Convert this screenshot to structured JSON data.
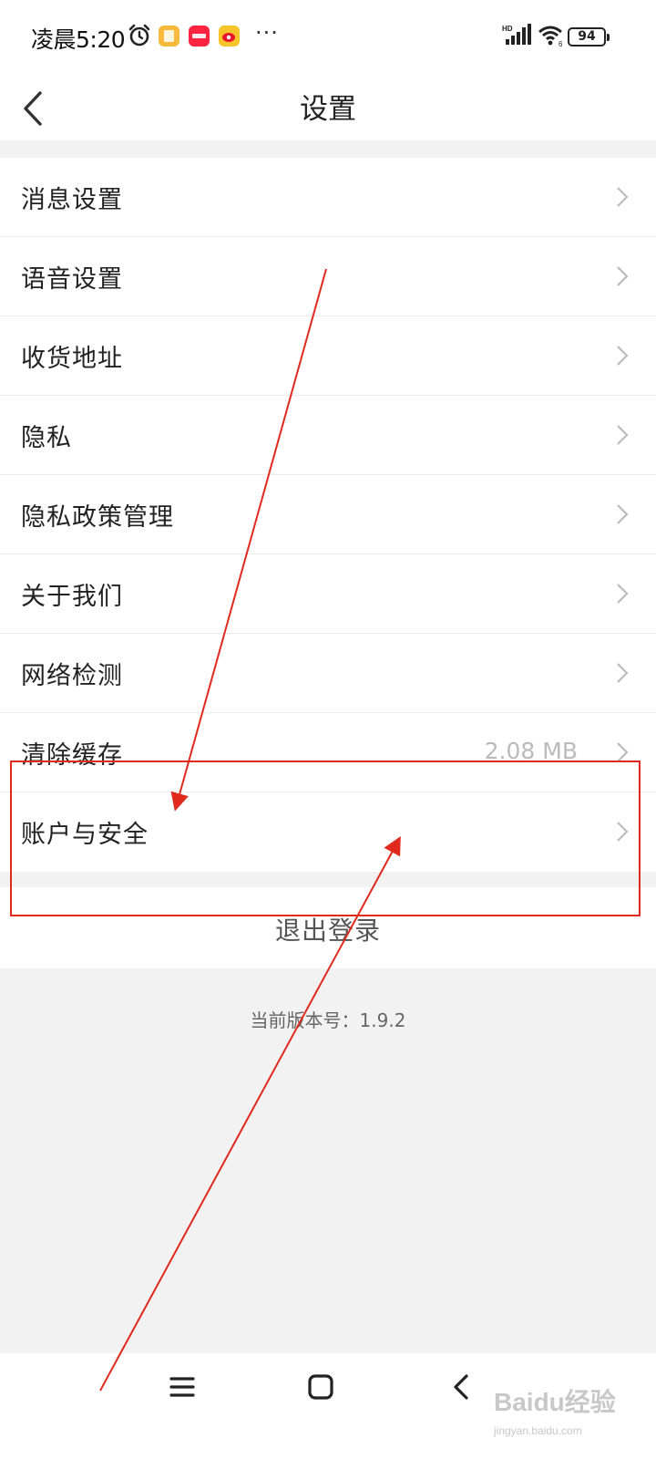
{
  "status_bar": {
    "time": "凌晨5:20",
    "more": "···",
    "battery": "94",
    "app_badges": [
      {
        "name": "notes-app-icon",
        "color": "#f6b93b"
      },
      {
        "name": "xiaohongshu-app-icon",
        "color": "#ff2442"
      },
      {
        "name": "weibo-app-icon",
        "color": "#f7c42a"
      }
    ]
  },
  "header": {
    "title": "设置"
  },
  "menu": {
    "items": [
      {
        "label": "消息设置"
      },
      {
        "label": "语音设置"
      },
      {
        "label": "收货地址"
      },
      {
        "label": "隐私"
      },
      {
        "label": "隐私政策管理"
      },
      {
        "label": "关于我们"
      },
      {
        "label": "网络检测"
      },
      {
        "label": "清除缓存",
        "value": "2.08 MB"
      },
      {
        "label": "账户与安全"
      }
    ]
  },
  "logout_label": "退出登录",
  "version_label": "当前版本号：1.9.2",
  "annotation_color": "#e02a1e",
  "watermark": {
    "brand": "Baidu经验",
    "url": "jingyan.baidu.com"
  }
}
